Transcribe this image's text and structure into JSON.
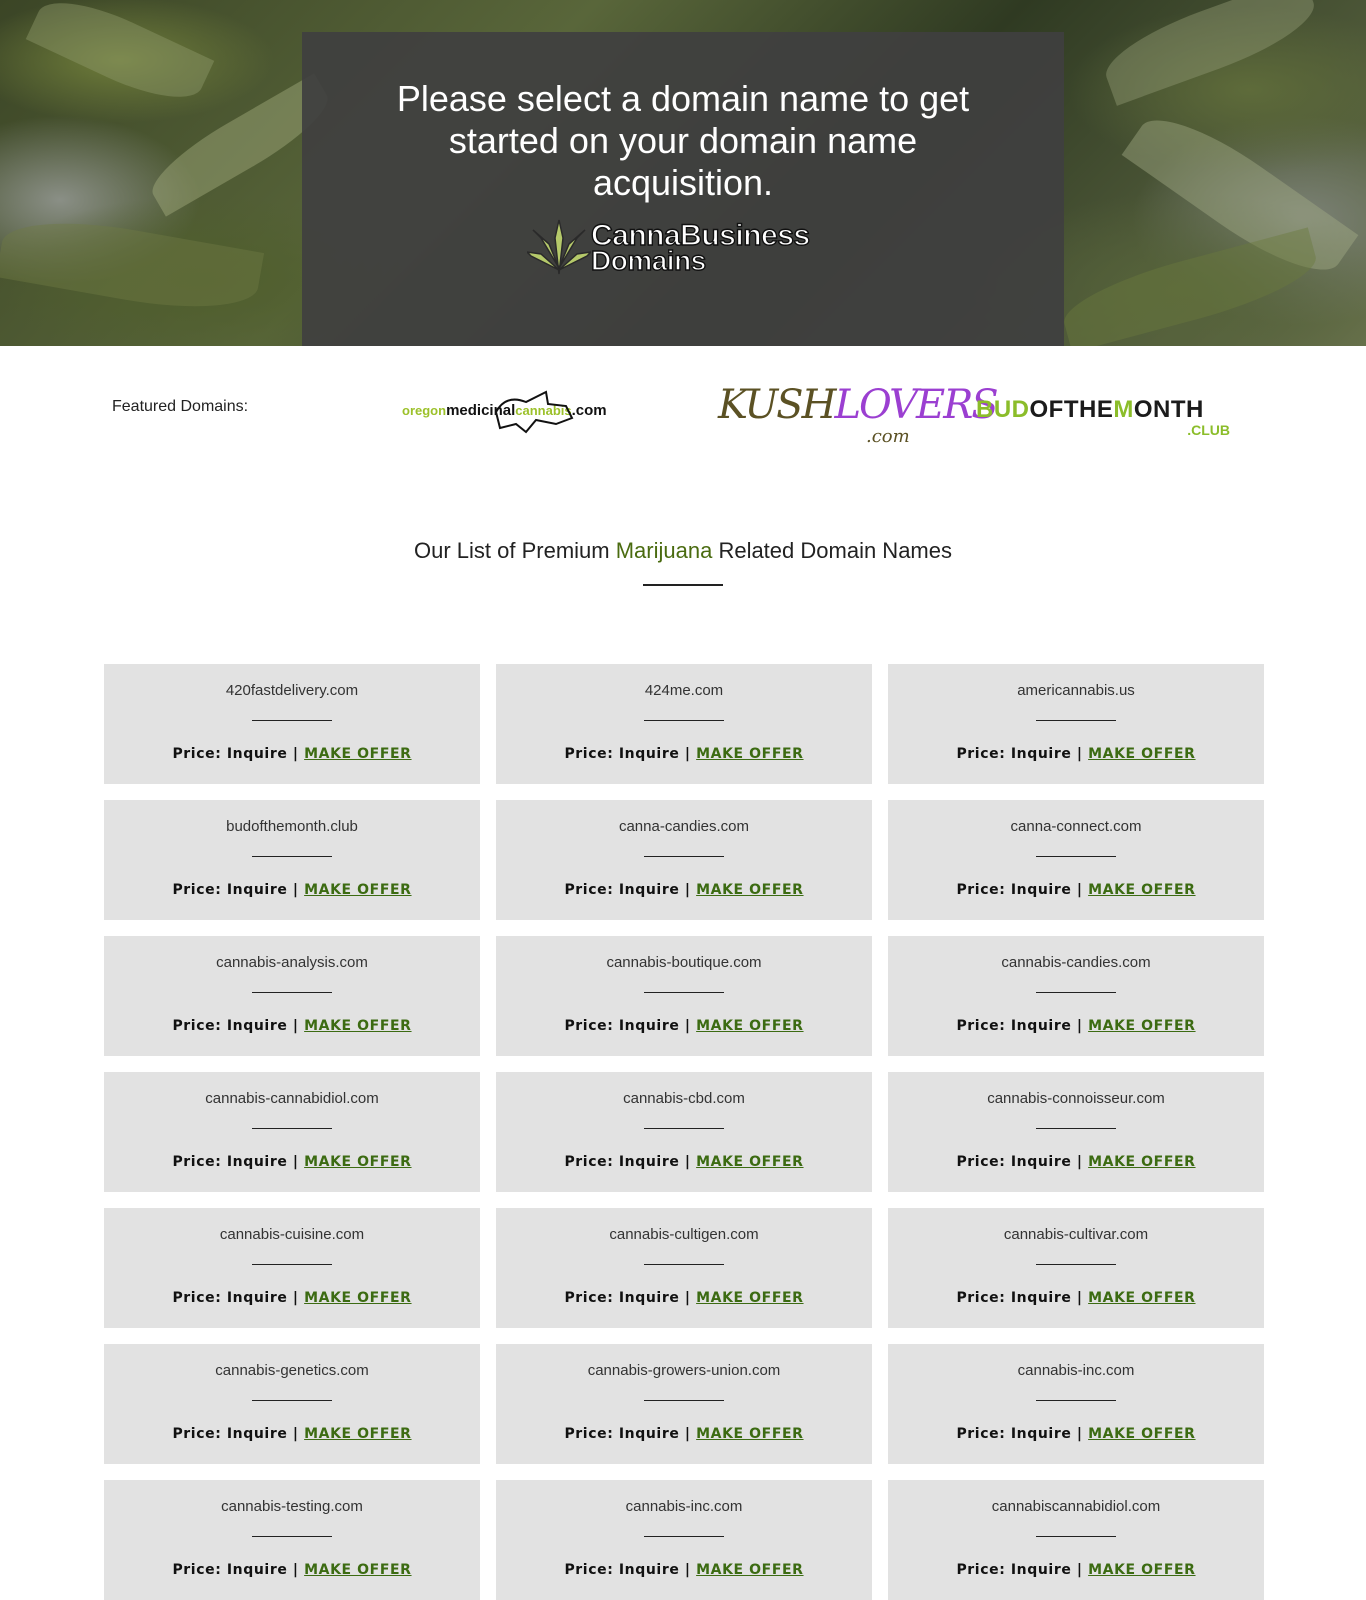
{
  "hero": {
    "title": "Please select a domain name to get started on your domain name acquisition.",
    "logo_word1": "CannaBusiness",
    "logo_word2": "Domains"
  },
  "featured": {
    "label": "Featured Domains:",
    "logos": [
      {
        "name": "oregonmedicinalcannabis.com",
        "part1": "oregon",
        "part2": "medicinal",
        "part3": "cannabis",
        "part4": ".com"
      },
      {
        "name": "kushlovers.com",
        "part1": "KUSH",
        "part2": "LOVERS",
        "part3": ".com"
      },
      {
        "name": "budofthemonth.club",
        "part1": "BUD",
        "part2": "OFTHE",
        "part3": "M",
        "part4": "ONTH",
        "part5": ".CLUB"
      }
    ]
  },
  "section": {
    "title_pre": "Our List of Premium ",
    "title_highlight": "Marijuana",
    "title_post": " Related Domain Names"
  },
  "card_labels": {
    "price": "Price: Inquire",
    "separator": " | ",
    "offer": "MAKE OFFER"
  },
  "domains": [
    "420fastdelivery.com",
    "424me.com",
    "americannabis.us",
    "budofthemonth.club",
    "canna-candies.com",
    "canna-connect.com",
    "cannabis-analysis.com",
    "cannabis-boutique.com",
    "cannabis-candies.com",
    "cannabis-cannabidiol.com",
    "cannabis-cbd.com",
    "cannabis-connoisseur.com",
    "cannabis-cuisine.com",
    "cannabis-cultigen.com",
    "cannabis-cultivar.com",
    "cannabis-genetics.com",
    "cannabis-growers-union.com",
    "cannabis-inc.com",
    "cannabis-testing.com",
    "cannabis-inc.com",
    "cannabiscannabidiol.com"
  ],
  "colors": {
    "hero_box": "#404040",
    "card_bg": "#e2e2e2",
    "offer_link": "#3c6b12",
    "accent_green": "#8bbd2a",
    "kush_purple": "#9b3fd1"
  }
}
